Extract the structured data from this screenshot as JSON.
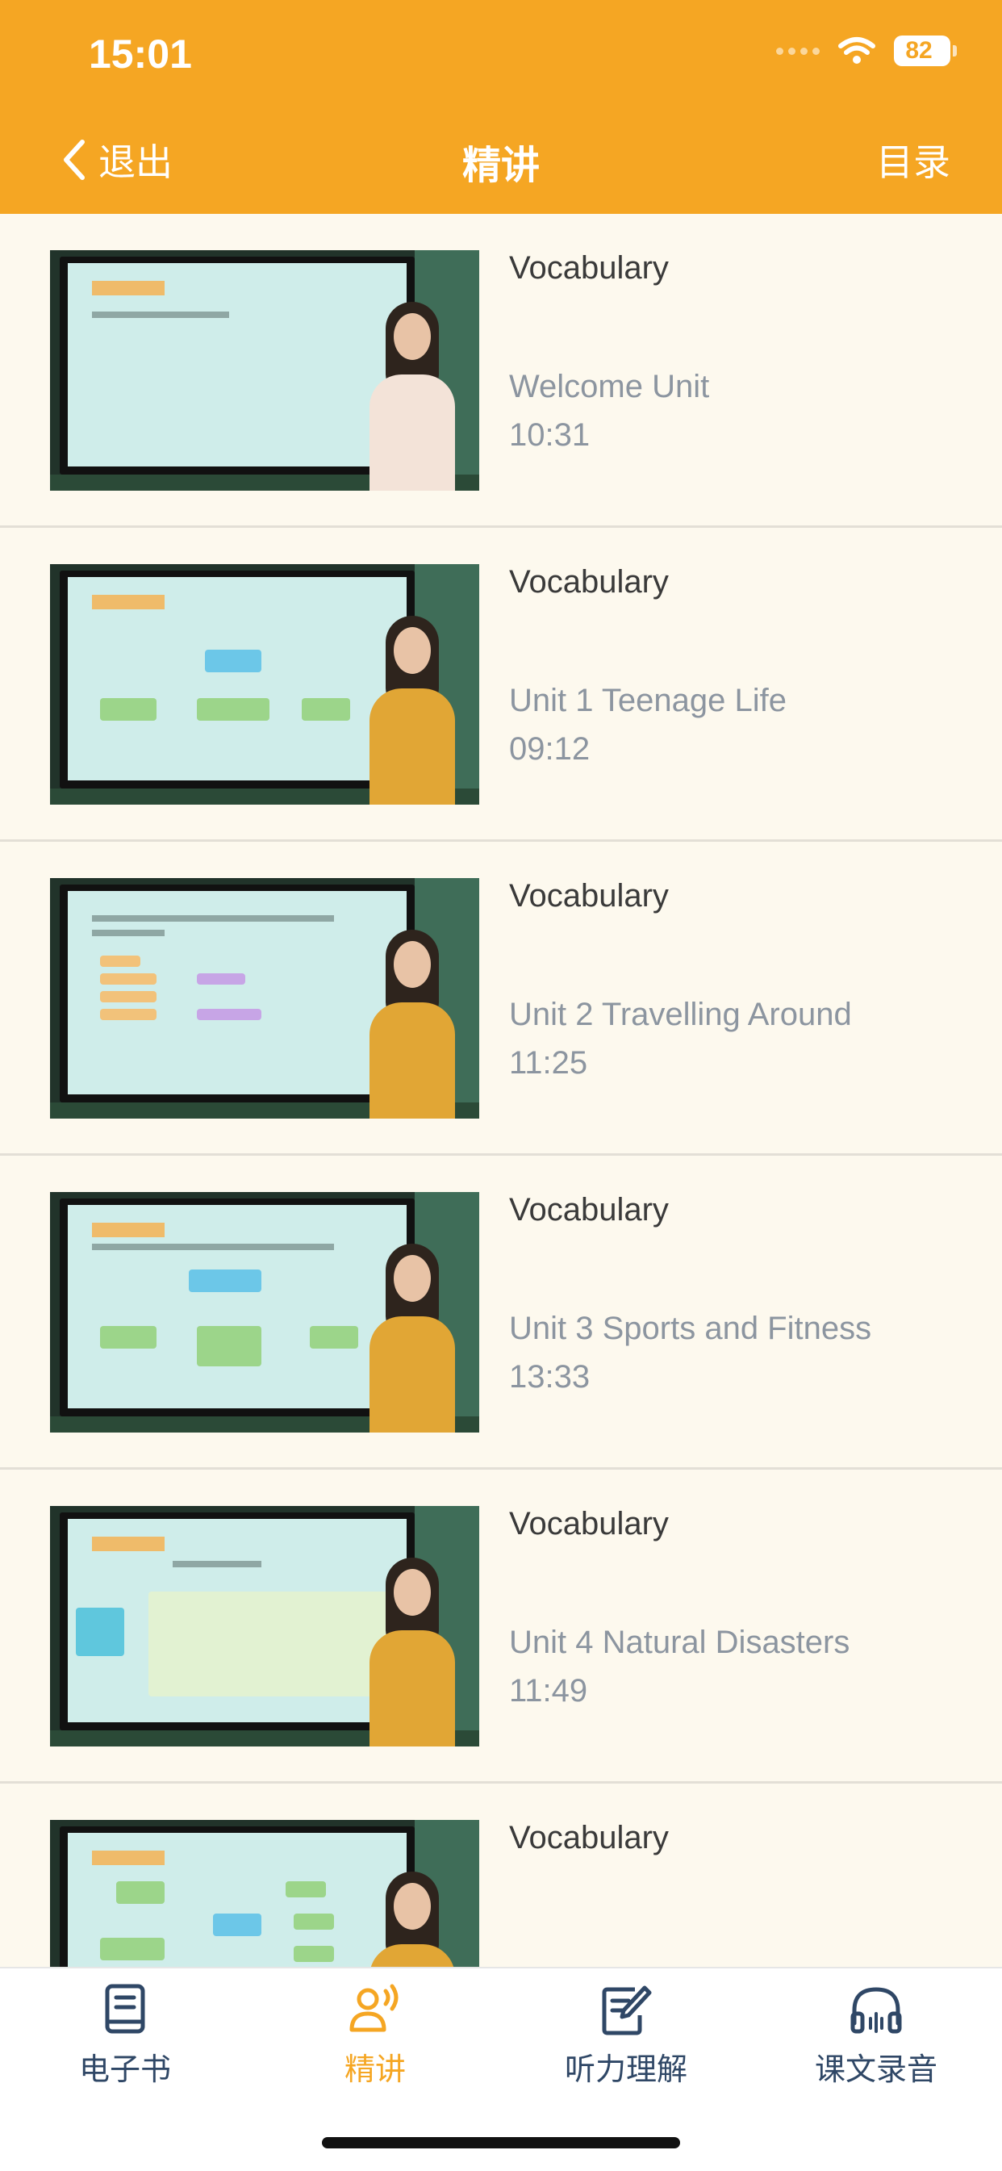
{
  "status_bar": {
    "time": "15:01",
    "battery": "82"
  },
  "nav": {
    "back_label": "退出",
    "title": "精讲",
    "right_label": "目录"
  },
  "lessons": [
    {
      "title": "Vocabulary",
      "unit": "Welcome Unit",
      "duration": "10:31"
    },
    {
      "title": "Vocabulary",
      "unit": "Unit 1 Teenage Life",
      "duration": "09:12"
    },
    {
      "title": "Vocabulary",
      "unit": "Unit 2 Travelling Around",
      "duration": "11:25"
    },
    {
      "title": "Vocabulary",
      "unit": "Unit 3 Sports and Fitness",
      "duration": "13:33"
    },
    {
      "title": "Vocabulary",
      "unit": "Unit 4 Natural Disasters",
      "duration": "11:49"
    },
    {
      "title": "Vocabulary"
    }
  ],
  "tabs": [
    {
      "label": "电子书",
      "icon": "book-icon"
    },
    {
      "label": "精讲",
      "icon": "lecture-icon",
      "active": true
    },
    {
      "label": "听力理解",
      "icon": "note-edit-icon"
    },
    {
      "label": "课文录音",
      "icon": "headphones-icon"
    }
  ],
  "colors": {
    "accent": "#F5A623",
    "background": "#FDF9EE",
    "tab_icon": "#2F4766"
  }
}
